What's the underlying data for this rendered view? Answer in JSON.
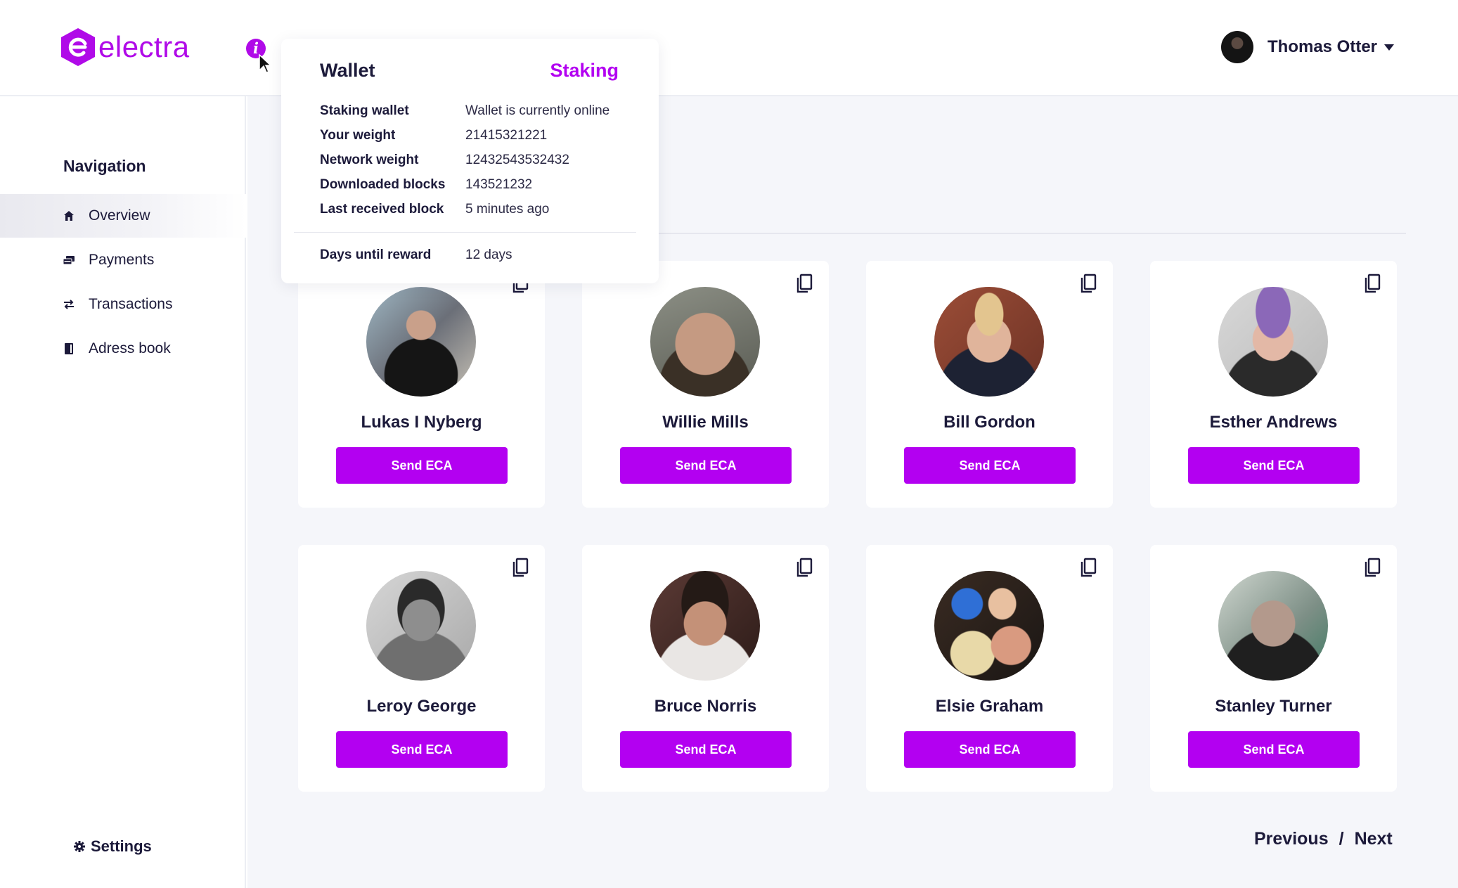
{
  "app": {
    "logo_text": "electra",
    "brand_color": "#b300f1"
  },
  "header": {
    "user_name": "Thomas Otter",
    "info_icon": "info-icon"
  },
  "sidebar": {
    "title": "Navigation",
    "items": [
      {
        "label": "Overview",
        "icon": "home-icon",
        "active": true
      },
      {
        "label": "Payments",
        "icon": "payments-icon",
        "active": false
      },
      {
        "label": "Transactions",
        "icon": "transfer-icon",
        "active": false
      },
      {
        "label": "Adress book",
        "icon": "book-icon",
        "active": false
      }
    ],
    "settings_label": "Settings"
  },
  "popup": {
    "title": "Wallet",
    "tab": "Staking",
    "rows": [
      {
        "key": "Staking wallet",
        "value": "Wallet is currently online"
      },
      {
        "key": "Your weight",
        "value": "21415321221"
      },
      {
        "key": "Network weight",
        "value": "12432543532432"
      },
      {
        "key": "Downloaded blocks",
        "value": "143521232"
      },
      {
        "key": "Last received block",
        "value": "5 minutes ago"
      }
    ],
    "footer": {
      "key": "Days until reward",
      "value": "12 days"
    }
  },
  "contacts": [
    {
      "name": "Lukas I Nyberg",
      "button": "Send ECA"
    },
    {
      "name": "Willie Mills",
      "button": "Send ECA"
    },
    {
      "name": "Bill Gordon",
      "button": "Send ECA"
    },
    {
      "name": "Esther Andrews",
      "button": "Send ECA"
    },
    {
      "name": "Leroy George",
      "button": "Send ECA"
    },
    {
      "name": "Bruce Norris",
      "button": "Send ECA"
    },
    {
      "name": "Elsie Graham",
      "button": "Send ECA"
    },
    {
      "name": "Stanley Turner",
      "button": "Send ECA"
    }
  ],
  "pagination": {
    "previous": "Previous",
    "separator": "/",
    "next": "Next"
  }
}
